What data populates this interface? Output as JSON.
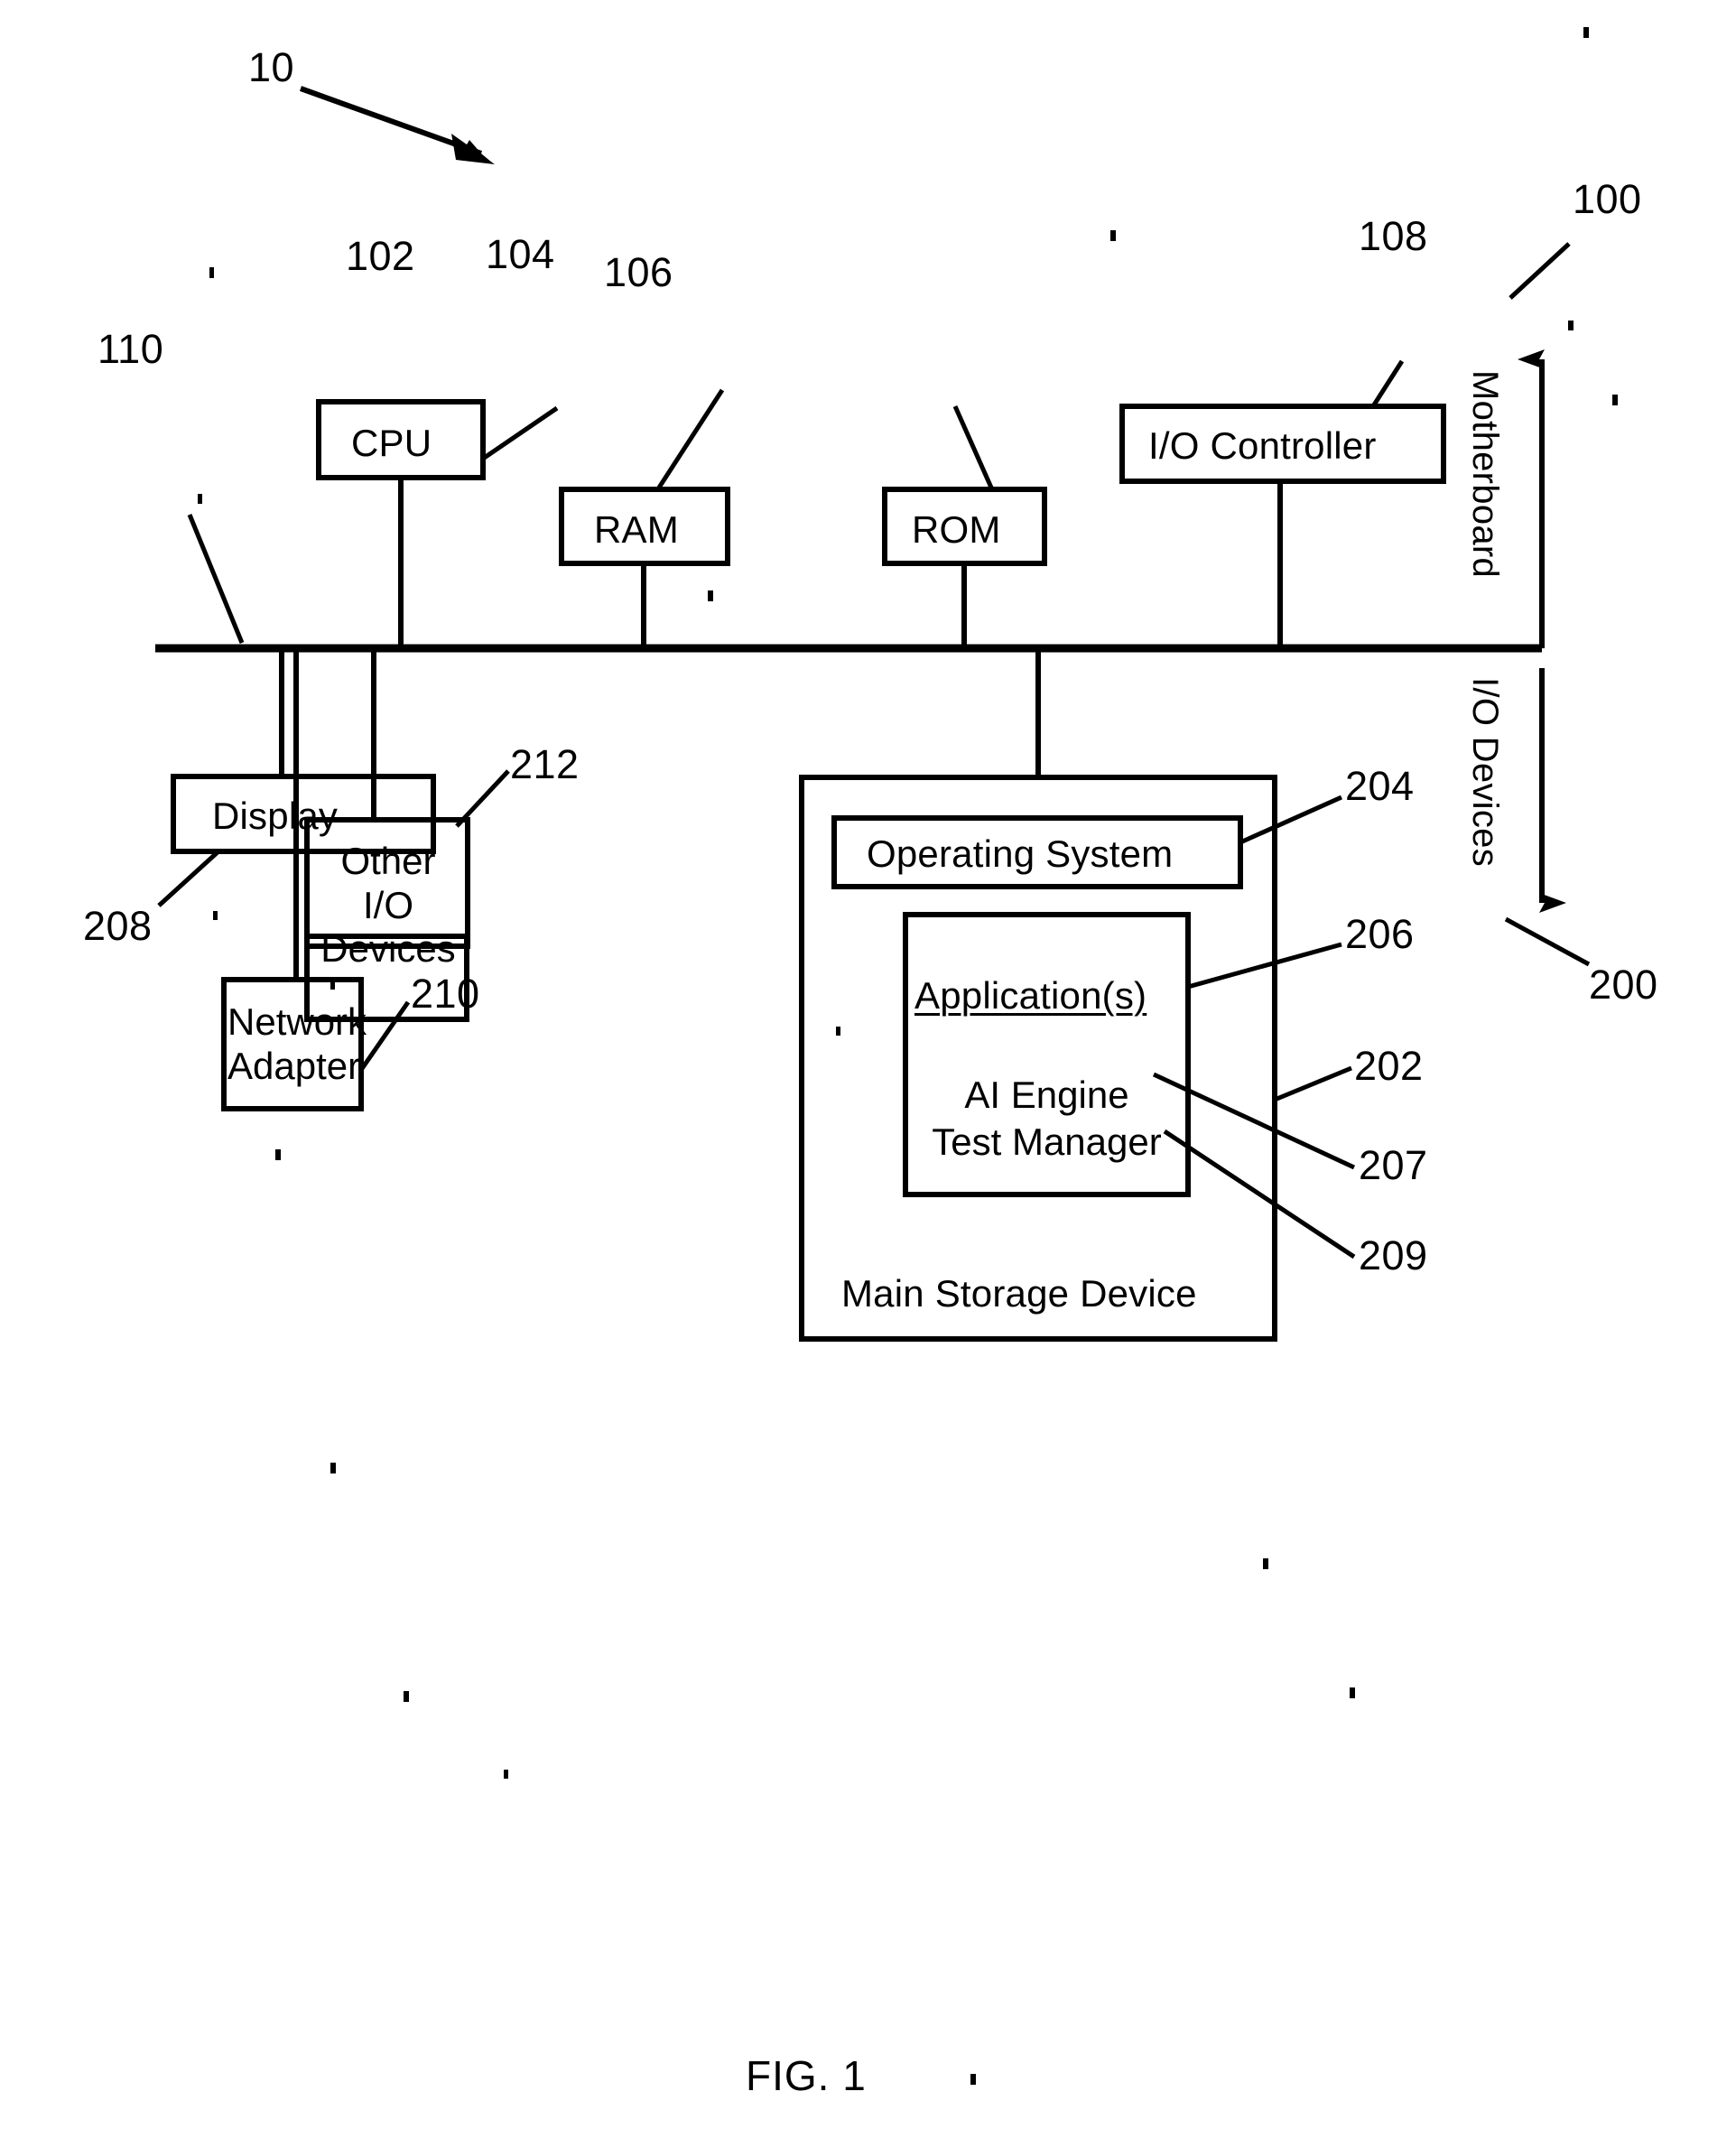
{
  "figure": {
    "caption": "FIG. 1",
    "system_ref": "10"
  },
  "regions": {
    "motherboard": {
      "label": "Motherboard",
      "ref": "100"
    },
    "io_devices": {
      "label": "I/O Devices",
      "ref": "200"
    }
  },
  "bus": {
    "ref": "110"
  },
  "blocks": {
    "cpu": {
      "label": "CPU",
      "ref": "102"
    },
    "ram": {
      "label": "RAM",
      "ref": "104"
    },
    "rom": {
      "label": "ROM",
      "ref": "106"
    },
    "io_controller": {
      "label": "I/O Controller",
      "ref": "108"
    },
    "display": {
      "label": "Display",
      "ref": "208"
    },
    "other_io_devices": {
      "label": "Other I/O Devices",
      "ref": "212"
    },
    "network_adapter": {
      "label": "Network Adapter",
      "ref": "210"
    },
    "main_storage_device": {
      "label": "Main Storage Device",
      "ref": "202"
    },
    "operating_system": {
      "label": "Operating System",
      "ref": "204"
    },
    "applications": {
      "label": "Application(s)",
      "ref": "206"
    },
    "ai_engine": {
      "label": "AI Engine",
      "ref": "207"
    },
    "test_manager": {
      "label": "Test Manager",
      "ref": "209"
    }
  }
}
